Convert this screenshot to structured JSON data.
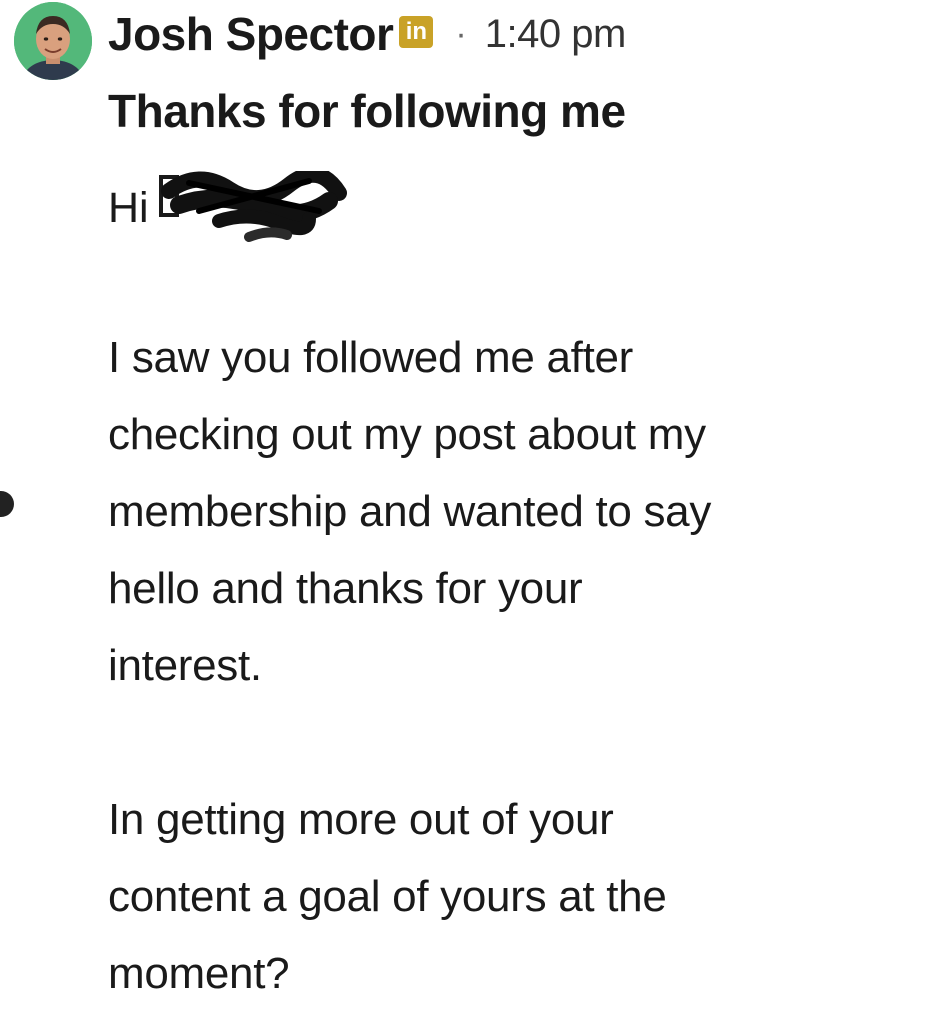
{
  "message": {
    "sender_name": "Josh Spector",
    "linkedin_badge": "in",
    "separator": "·",
    "timestamp": "1:40 pm",
    "subject": "Thanks for following me",
    "greeting": "Hi",
    "body": {
      "paragraph_1": [
        "I saw you followed me after",
        "checking out my post about my",
        "membership and wanted to say",
        "hello and thanks for your",
        "interest."
      ],
      "paragraph_2": [
        "In getting more out of your",
        "content a goal of yours at the",
        "moment?"
      ]
    }
  },
  "icons": {
    "avatar": "profile-photo",
    "badge": "linkedin-premium-badge",
    "redaction": "scribble-redaction"
  },
  "colors": {
    "avatar_bg": "#53b87a",
    "badge_bg": "#c9a227",
    "text": "#1a1a1a"
  }
}
